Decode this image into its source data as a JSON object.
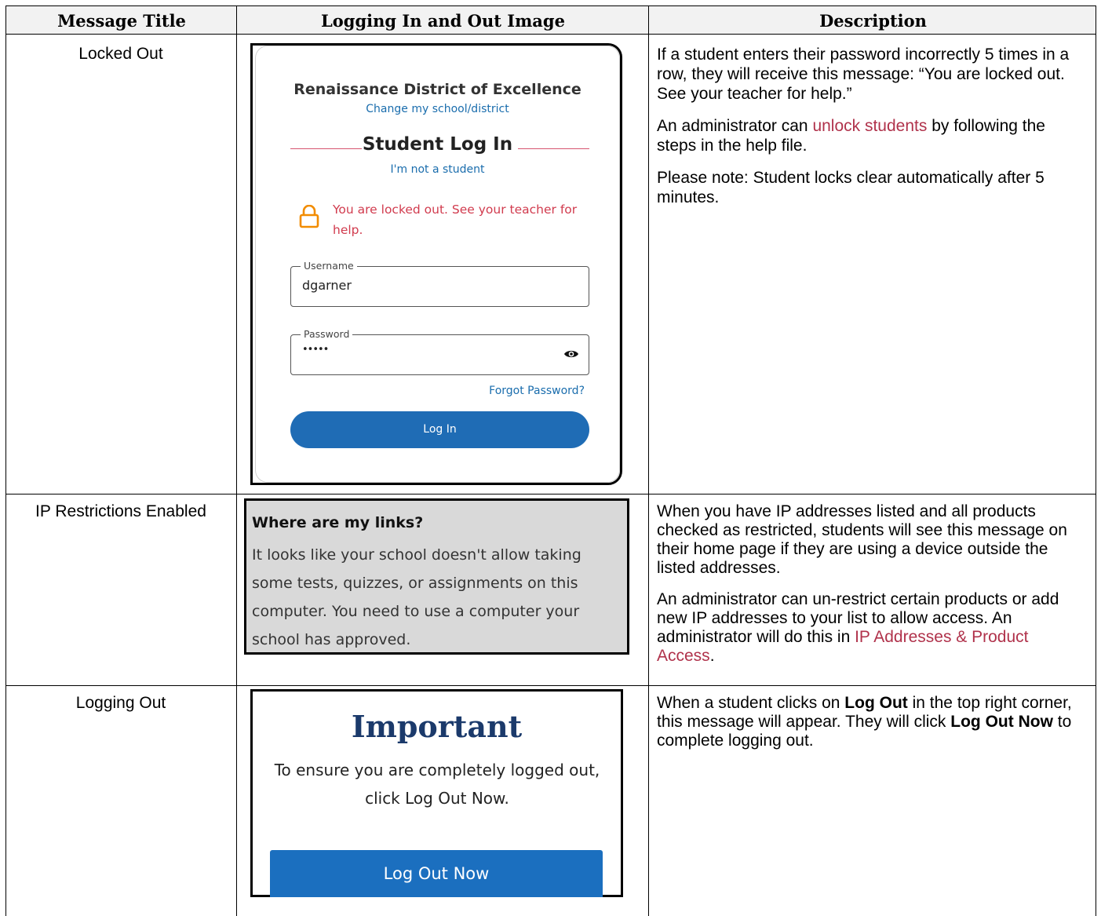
{
  "headers": {
    "title": "Message Title",
    "image": "Logging In and Out Image",
    "description": "Description"
  },
  "rows": [
    {
      "title": "Locked Out",
      "desc": {
        "p1": "If a student enters their password incorrectly 5 times in a row, they will receive this message: “You are locked out. See your teacher for help.”",
        "p2_before": "An administrator can ",
        "p2_link": "unlock students",
        "p2_after": " by following the steps in the help file.",
        "p3": "Please note: Student locks clear automatically after 5 minutes."
      },
      "screenshot": {
        "district": "Renaissance District of Excellence",
        "change_link": "Change my school/district",
        "heading": "Student Log In",
        "not_student_link": "I'm not a student",
        "lock_icon": "lock-icon",
        "lock_message": "You are locked out. See your teacher for help.",
        "username_label": "Username",
        "username_value": "dgarner",
        "password_label": "Password",
        "password_value": "•••••",
        "eye_icon": "eye-icon",
        "forgot_link": "Forgot Password?",
        "login_button": "Log In",
        "colors": {
          "accent_blue": "#1f6cb5",
          "error_red": "#d13b4e",
          "lock_orange": "#f28c00",
          "rule_pink": "#d65470"
        }
      }
    },
    {
      "title": "IP Restrictions Enabled",
      "desc": {
        "p1": "When you have IP addresses listed and all products checked as restricted, students will see this message on their home page if they are using a device outside the listed addresses.",
        "p2_before": "An administrator can un-restrict certain products or add new IP addresses to your list to allow access. An administrator will do this in ",
        "p2_link": "IP Addresses & Product Access",
        "p2_after": "."
      },
      "screenshot": {
        "heading": "Where are my links?",
        "body": "It looks like your school doesn't allow taking some tests, quizzes, or assignments on this computer. You need to use a computer your school has approved."
      }
    },
    {
      "title": "Logging Out",
      "desc": {
        "p1_before": "When a student clicks on ",
        "p1_bold1": "Log Out",
        "p1_mid": " in the top right corner, this message will appear. They will click ",
        "p1_bold2": "Log Out Now",
        "p1_after": " to complete logging out."
      },
      "screenshot": {
        "heading": "Important",
        "message": "To ensure you are completely logged out, click Log Out Now.",
        "button": "Log Out Now"
      }
    }
  ]
}
